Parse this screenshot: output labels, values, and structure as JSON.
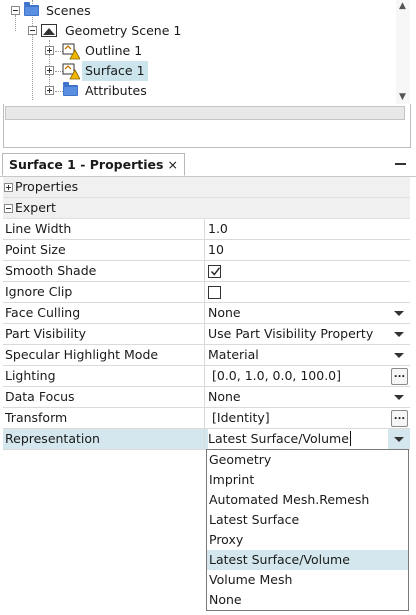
{
  "tree": {
    "items": [
      {
        "label": "Scenes",
        "icon": "folder-icon",
        "expander": "minus"
      },
      {
        "label": "Geometry Scene 1",
        "icon": "scene-icon",
        "expander": "minus"
      },
      {
        "label": "Outline 1",
        "icon": "scene-part-icon",
        "expander": "plus"
      },
      {
        "label": "Surface 1",
        "icon": "scene-part-icon",
        "expander": "plus",
        "selected": true
      },
      {
        "label": "Attributes",
        "icon": "folder-icon",
        "expander": "plus"
      }
    ]
  },
  "properties": {
    "tab_title": "Surface 1 - Properties",
    "tab_close": "×",
    "sections": {
      "properties": "Properties",
      "expert": "Expert"
    },
    "rows": {
      "line_width": {
        "name": "Line Width",
        "value": "1.0"
      },
      "point_size": {
        "name": "Point Size",
        "value": "10"
      },
      "smooth_shade": {
        "name": "Smooth Shade",
        "checked": true
      },
      "ignore_clip": {
        "name": "Ignore Clip",
        "checked": false
      },
      "face_culling": {
        "name": "Face Culling",
        "value": "None"
      },
      "part_visibility": {
        "name": "Part Visibility",
        "value": "Use Part Visibility Property"
      },
      "specular_highlight_mode": {
        "name": "Specular Highlight Mode",
        "value": "Material"
      },
      "lighting": {
        "name": "Lighting",
        "value": "[0.0, 1.0, 0.0, 100.0]",
        "button": "..."
      },
      "data_focus": {
        "name": "Data Focus",
        "value": "None"
      },
      "transform": {
        "name": "Transform",
        "value": "[Identity]",
        "button": "..."
      },
      "representation": {
        "name": "Representation",
        "value": "Latest Surface/Volume"
      }
    }
  },
  "representation_dropdown": {
    "options": [
      "Geometry",
      "Imprint",
      "Automated Mesh.Remesh",
      "Latest Surface",
      "Proxy",
      "Latest Surface/Volume",
      "Volume Mesh",
      "None"
    ],
    "selected": "Latest Surface/Volume"
  },
  "colors": {
    "selection": "#cce4ec",
    "row_highlight": "#d4e7ee",
    "folder": "#3d73c8"
  }
}
